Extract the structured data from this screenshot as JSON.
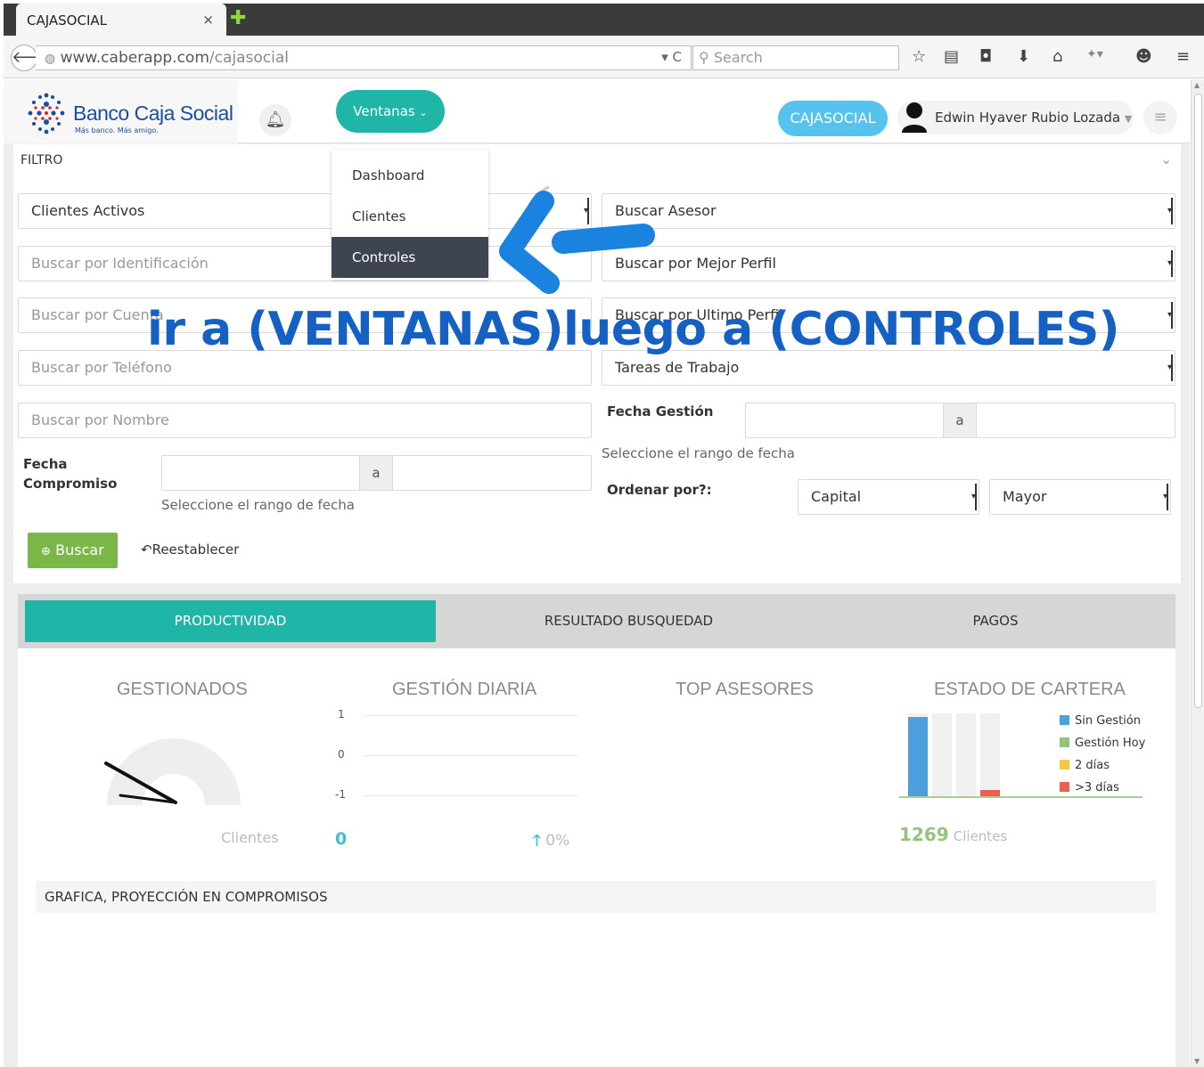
{
  "browser": {
    "tab_title": "CAJASOCIAL",
    "tab_close": "×",
    "url_domain": "www.caberapp.com",
    "url_path": "/cajasocial",
    "search_placeholder": "Search"
  },
  "header": {
    "logo_name": "Banco Caja Social",
    "logo_tagline": "Más banco. Más amigo.",
    "ventanas_label": "Ventanas",
    "org_badge": "CAJASOCIAL",
    "user_name": "Edwin Hyaver Rubio Lozada"
  },
  "ventanas_menu": {
    "items": [
      "Dashboard",
      "Clientes",
      "Controles"
    ],
    "active": "Controles"
  },
  "filter": {
    "title": "FILTRO",
    "clientes_select": "Clientes Activos",
    "buscar_asesor": "Buscar Asesor",
    "id_placeholder": "Buscar por Identificación",
    "mejor_perfil": "Buscar por Mejor Perfil",
    "cuenta_placeholder": "Buscar por Cuenta",
    "ultimo_perfil": "Buscar por Ultimo Perfil",
    "telefono_placeholder": "Buscar por Teléfono",
    "tareas": "Tareas de Trabajo",
    "nombre_placeholder": "Buscar por Nombre",
    "fecha_gestion_label": "Fecha Gestión",
    "date_sep": "a",
    "rango_help": "Seleccione el rango de fecha",
    "fecha_compromiso_line1": "Fecha",
    "fecha_compromiso_line2": "Compromiso",
    "ordenar_label": "Ordenar por?:",
    "ordenar_campo": "Capital",
    "ordenar_dir": "Mayor",
    "buscar_btn": "Buscar",
    "reset_btn": "Reestablecer"
  },
  "tabs": [
    "PRODUCTIVIDAD",
    "RESULTADO BUSQUEDAD",
    "PAGOS"
  ],
  "stats": {
    "gestionados_title": "GESTIONADOS",
    "gestionados_unit": "Clientes",
    "gestion_diaria_title": "GESTIÓN DIARIA",
    "gestion_diaria_value": "0",
    "gestion_diaria_change": "0%",
    "top_asesores_title": "TOP ASESORES",
    "estado_title": "ESTADO DE CARTERA",
    "estado_total": "1269",
    "estado_unit": "Clientes",
    "proyeccion_title": "GRAFICA, PROYECCIÓN EN COMPROMISOS"
  },
  "chart_data": [
    {
      "type": "line",
      "title": "GESTIÓN DIARIA",
      "y_ticks": [
        "1",
        "0",
        "-1"
      ],
      "ylim": [
        -1,
        1
      ],
      "series": []
    },
    {
      "type": "bar",
      "title": "ESTADO DE CARTERA",
      "series": [
        {
          "name": "Sin Gestión",
          "color": "#4a9fdc",
          "values": [
            1,
            0,
            0,
            0
          ]
        },
        {
          "name": "Gestión Hoy",
          "color": "#94c47c",
          "values": [
            0,
            0,
            0,
            0
          ]
        },
        {
          "name": "2 días",
          "color": "#f5c842",
          "values": [
            0,
            0,
            0,
            0
          ]
        },
        {
          "name": ">3 días",
          "color": "#e8604f",
          "values": [
            0,
            0,
            0,
            0.08
          ]
        }
      ]
    }
  ],
  "annotation": {
    "text": "ir a (VENTANAS)luego a (CONTROLES)"
  }
}
